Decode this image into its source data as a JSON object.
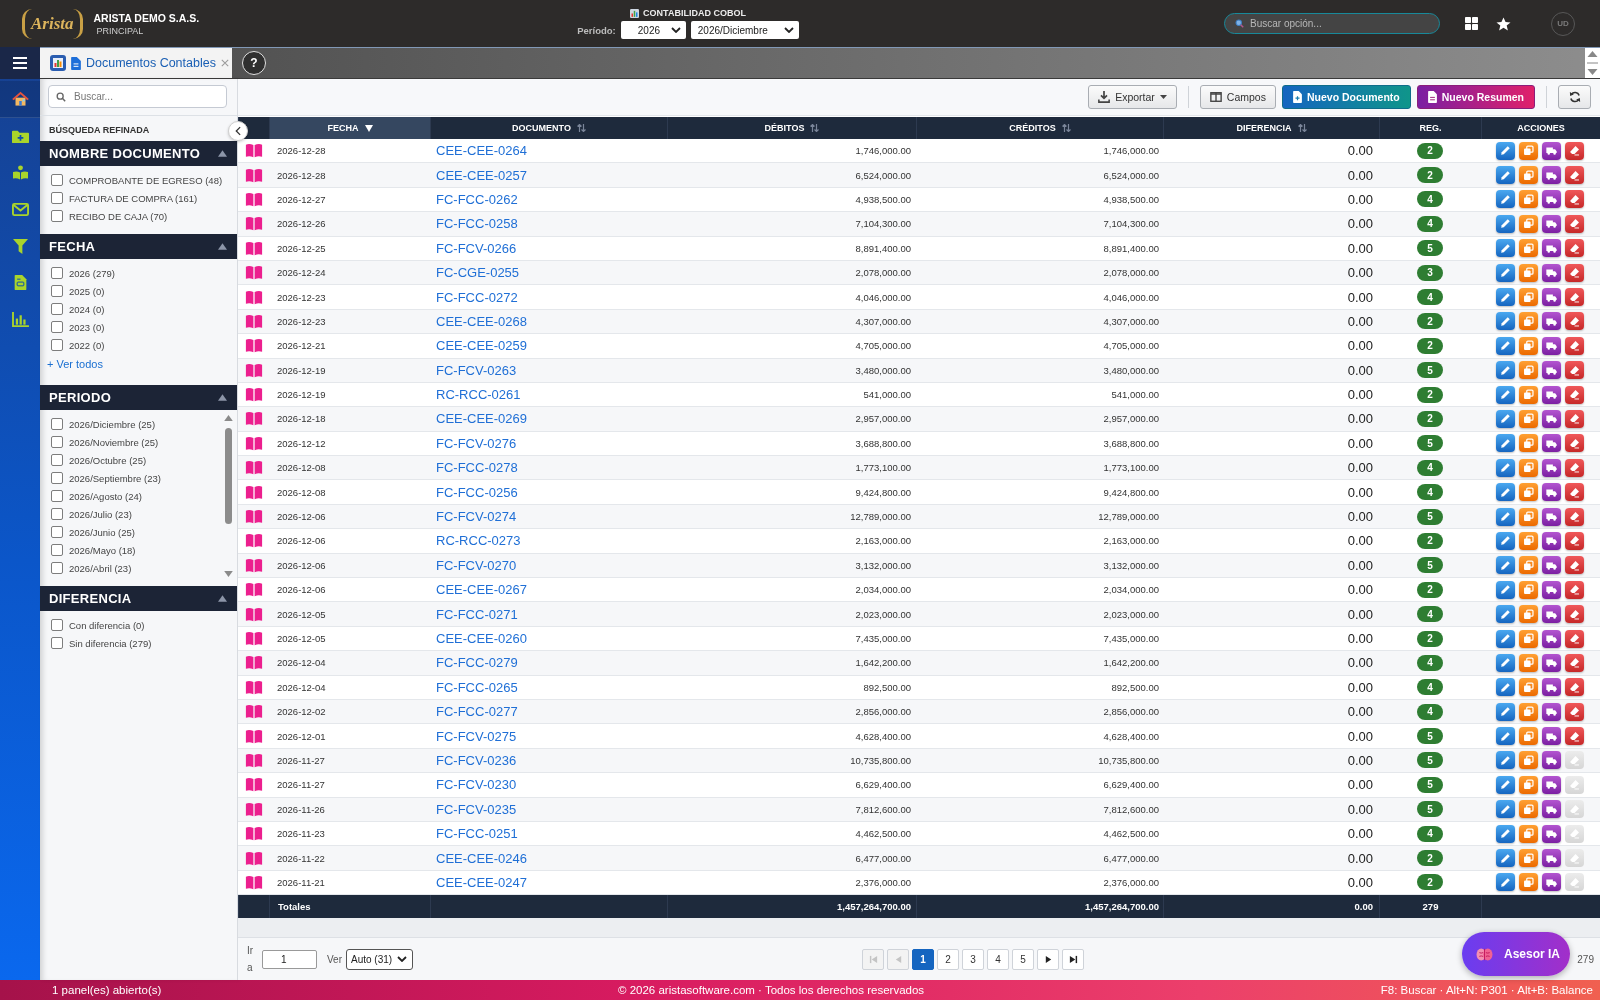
{
  "header": {
    "logo": "Arista",
    "company": "ARISTA DEMO S.A.S.",
    "branch": "PRINCIPAL",
    "module": "CONTABILIDAD COBOL",
    "period_label": "Período:",
    "year": "2026",
    "month": "2026/Diciembre",
    "search": {
      "placeholder": "Buscar opción..."
    },
    "avatar": "UD"
  },
  "nav_items": [
    {
      "kind": "home",
      "selected": true
    },
    {
      "kind": "folder-plus",
      "selected": false
    },
    {
      "kind": "reader",
      "selected": false
    },
    {
      "kind": "mail",
      "selected": false
    },
    {
      "kind": "filter",
      "selected": false
    },
    {
      "kind": "report",
      "selected": false
    },
    {
      "kind": "chart",
      "selected": false
    }
  ],
  "tabs": [
    {
      "label": "Documentos Contables",
      "selected": true
    }
  ],
  "help_button": "?",
  "filters": {
    "search": {
      "placeholder": "Buscar..."
    },
    "title": "BÚSQUEDA REFINADA",
    "sections": [
      {
        "title": "NOMBRE DOCUMENTO",
        "expanded": true,
        "kind": "list",
        "items": [
          {
            "label": "COMPROBANTE DE EGRESO (48)",
            "checked": false
          },
          {
            "label": "FACTURA DE COMPRA (161)",
            "checked": false
          },
          {
            "label": "RECIBO DE CAJA (70)",
            "checked": false
          }
        ]
      },
      {
        "title": "FECHA",
        "expanded": true,
        "kind": "list",
        "items": [
          {
            "label": "2026 (279)",
            "checked": false
          },
          {
            "label": "2025 (0)",
            "checked": false
          },
          {
            "label": "2024 (0)",
            "checked": false
          },
          {
            "label": "2023 (0)",
            "checked": false
          },
          {
            "label": "2022 (0)",
            "checked": false
          }
        ],
        "more_link": "+ Ver todos"
      },
      {
        "title": "PERIODO",
        "expanded": true,
        "kind": "scroll",
        "items": [
          {
            "label": "2026/Diciembre (25)",
            "checked": false
          },
          {
            "label": "2026/Noviembre (25)",
            "checked": false
          },
          {
            "label": "2026/Octubre (25)",
            "checked": false
          },
          {
            "label": "2026/Septiembre (23)",
            "checked": false
          },
          {
            "label": "2026/Agosto (24)",
            "checked": false
          },
          {
            "label": "2026/Julio (23)",
            "checked": false
          },
          {
            "label": "2026/Junio (25)",
            "checked": false
          },
          {
            "label": "2026/Mayo (18)",
            "checked": false
          },
          {
            "label": "2026/Abril (23)",
            "checked": false
          }
        ]
      },
      {
        "title": "DIFERENCIA",
        "expanded": true,
        "kind": "list",
        "items": [
          {
            "label": "Con diferencia (0)",
            "checked": false
          },
          {
            "label": "Sin diferencia (279)",
            "checked": false
          }
        ]
      }
    ]
  },
  "toolbar": {
    "buttons": [
      {
        "kind": "export",
        "label": "Exportar"
      },
      {
        "kind": "fields",
        "label": "Campos"
      },
      {
        "kind": "new-document",
        "label": "Nuevo Documento"
      },
      {
        "kind": "new-summary",
        "label": "Nuevo Resumen"
      },
      {
        "kind": "refresh"
      }
    ]
  },
  "table": {
    "columns": [
      {
        "label": "FECHA",
        "sortable": true,
        "sorted": true
      },
      {
        "label": "DOCUMENTO",
        "sortable": true,
        "sorted": false
      },
      {
        "label": "DÉBITOS",
        "sortable": true,
        "sorted": false
      },
      {
        "label": "CRÉDITOS",
        "sortable": true,
        "sorted": false
      },
      {
        "label": "DIFERENCIA",
        "sortable": true,
        "sorted": false
      },
      {
        "label": "REG.",
        "sortable": false,
        "sorted": false
      },
      {
        "label": "ACCIONES",
        "sortable": false,
        "sorted": false
      }
    ],
    "rows": [
      {
        "date": "2026-12-28",
        "document": "CEE-CEE-0264",
        "debit": "1,746,000.00",
        "credit": "1,746,000.00",
        "difference": "0.00",
        "entries": "2",
        "delete_disabled": false
      },
      {
        "date": "2026-12-28",
        "document": "CEE-CEE-0257",
        "debit": "6,524,000.00",
        "credit": "6,524,000.00",
        "difference": "0.00",
        "entries": "2",
        "delete_disabled": false
      },
      {
        "date": "2026-12-27",
        "document": "FC-FCC-0262",
        "debit": "4,938,500.00",
        "credit": "4,938,500.00",
        "difference": "0.00",
        "entries": "4",
        "delete_disabled": false
      },
      {
        "date": "2026-12-26",
        "document": "FC-FCC-0258",
        "debit": "7,104,300.00",
        "credit": "7,104,300.00",
        "difference": "0.00",
        "entries": "4",
        "delete_disabled": false
      },
      {
        "date": "2026-12-25",
        "document": "FC-FCV-0266",
        "debit": "8,891,400.00",
        "credit": "8,891,400.00",
        "difference": "0.00",
        "entries": "5",
        "delete_disabled": false
      },
      {
        "date": "2026-12-24",
        "document": "FC-CGE-0255",
        "debit": "2,078,000.00",
        "credit": "2,078,000.00",
        "difference": "0.00",
        "entries": "3",
        "delete_disabled": false
      },
      {
        "date": "2026-12-23",
        "document": "FC-FCC-0272",
        "debit": "4,046,000.00",
        "credit": "4,046,000.00",
        "difference": "0.00",
        "entries": "4",
        "delete_disabled": false
      },
      {
        "date": "2026-12-23",
        "document": "CEE-CEE-0268",
        "debit": "4,307,000.00",
        "credit": "4,307,000.00",
        "difference": "0.00",
        "entries": "2",
        "delete_disabled": false
      },
      {
        "date": "2026-12-21",
        "document": "CEE-CEE-0259",
        "debit": "4,705,000.00",
        "credit": "4,705,000.00",
        "difference": "0.00",
        "entries": "2",
        "delete_disabled": false
      },
      {
        "date": "2026-12-19",
        "document": "FC-FCV-0263",
        "debit": "3,480,000.00",
        "credit": "3,480,000.00",
        "difference": "0.00",
        "entries": "5",
        "delete_disabled": false
      },
      {
        "date": "2026-12-19",
        "document": "RC-RCC-0261",
        "debit": "541,000.00",
        "credit": "541,000.00",
        "difference": "0.00",
        "entries": "2",
        "delete_disabled": false
      },
      {
        "date": "2026-12-18",
        "document": "CEE-CEE-0269",
        "debit": "2,957,000.00",
        "credit": "2,957,000.00",
        "difference": "0.00",
        "entries": "2",
        "delete_disabled": false
      },
      {
        "date": "2026-12-12",
        "document": "FC-FCV-0276",
        "debit": "3,688,800.00",
        "credit": "3,688,800.00",
        "difference": "0.00",
        "entries": "5",
        "delete_disabled": false
      },
      {
        "date": "2026-12-08",
        "document": "FC-FCC-0278",
        "debit": "1,773,100.00",
        "credit": "1,773,100.00",
        "difference": "0.00",
        "entries": "4",
        "delete_disabled": false
      },
      {
        "date": "2026-12-08",
        "document": "FC-FCC-0256",
        "debit": "9,424,800.00",
        "credit": "9,424,800.00",
        "difference": "0.00",
        "entries": "4",
        "delete_disabled": false
      },
      {
        "date": "2026-12-06",
        "document": "FC-FCV-0274",
        "debit": "12,789,000.00",
        "credit": "12,789,000.00",
        "difference": "0.00",
        "entries": "5",
        "delete_disabled": false
      },
      {
        "date": "2026-12-06",
        "document": "RC-RCC-0273",
        "debit": "2,163,000.00",
        "credit": "2,163,000.00",
        "difference": "0.00",
        "entries": "2",
        "delete_disabled": false
      },
      {
        "date": "2026-12-06",
        "document": "FC-FCV-0270",
        "debit": "3,132,000.00",
        "credit": "3,132,000.00",
        "difference": "0.00",
        "entries": "5",
        "delete_disabled": false
      },
      {
        "date": "2026-12-06",
        "document": "CEE-CEE-0267",
        "debit": "2,034,000.00",
        "credit": "2,034,000.00",
        "difference": "0.00",
        "entries": "2",
        "delete_disabled": false
      },
      {
        "date": "2026-12-05",
        "document": "FC-FCC-0271",
        "debit": "2,023,000.00",
        "credit": "2,023,000.00",
        "difference": "0.00",
        "entries": "4",
        "delete_disabled": false
      },
      {
        "date": "2026-12-05",
        "document": "CEE-CEE-0260",
        "debit": "7,435,000.00",
        "credit": "7,435,000.00",
        "difference": "0.00",
        "entries": "2",
        "delete_disabled": false
      },
      {
        "date": "2026-12-04",
        "document": "FC-FCC-0279",
        "debit": "1,642,200.00",
        "credit": "1,642,200.00",
        "difference": "0.00",
        "entries": "4",
        "delete_disabled": false
      },
      {
        "date": "2026-12-04",
        "document": "FC-FCC-0265",
        "debit": "892,500.00",
        "credit": "892,500.00",
        "difference": "0.00",
        "entries": "4",
        "delete_disabled": false
      },
      {
        "date": "2026-12-02",
        "document": "FC-FCC-0277",
        "debit": "2,856,000.00",
        "credit": "2,856,000.00",
        "difference": "0.00",
        "entries": "4",
        "delete_disabled": false
      },
      {
        "date": "2026-12-01",
        "document": "FC-FCV-0275",
        "debit": "4,628,400.00",
        "credit": "4,628,400.00",
        "difference": "0.00",
        "entries": "5",
        "delete_disabled": false
      },
      {
        "date": "2026-11-27",
        "document": "FC-FCV-0236",
        "debit": "10,735,800.00",
        "credit": "10,735,800.00",
        "difference": "0.00",
        "entries": "5",
        "delete_disabled": true
      },
      {
        "date": "2026-11-27",
        "document": "FC-FCV-0230",
        "debit": "6,629,400.00",
        "credit": "6,629,400.00",
        "difference": "0.00",
        "entries": "5",
        "delete_disabled": true
      },
      {
        "date": "2026-11-26",
        "document": "FC-FCV-0235",
        "debit": "7,812,600.00",
        "credit": "7,812,600.00",
        "difference": "0.00",
        "entries": "5",
        "delete_disabled": true
      },
      {
        "date": "2026-11-23",
        "document": "FC-FCC-0251",
        "debit": "4,462,500.00",
        "credit": "4,462,500.00",
        "difference": "0.00",
        "entries": "4",
        "delete_disabled": true
      },
      {
        "date": "2026-11-22",
        "document": "CEE-CEE-0246",
        "debit": "6,477,000.00",
        "credit": "6,477,000.00",
        "difference": "0.00",
        "entries": "2",
        "delete_disabled": true
      },
      {
        "date": "2026-11-21",
        "document": "CEE-CEE-0247",
        "debit": "2,376,000.00",
        "credit": "2,376,000.00",
        "difference": "0.00",
        "entries": "2",
        "delete_disabled": true
      }
    ],
    "totals": {
      "label": "Totales",
      "debit": "1,457,264,700.00",
      "credit": "1,457,264,700.00",
      "difference": "0.00",
      "entries": "279"
    }
  },
  "pagination": {
    "goto_label": "Ir a",
    "goto_value": "1",
    "view_label": "Ver",
    "view_value": "Auto (31)",
    "nav_start": [
      {
        "kind": "first",
        "disabled": true
      },
      {
        "kind": "prev",
        "disabled": true
      }
    ],
    "pages": [
      {
        "label": "1",
        "selected": true
      },
      {
        "label": "2",
        "selected": false
      },
      {
        "label": "3",
        "selected": false
      },
      {
        "label": "4",
        "selected": false
      },
      {
        "label": "5",
        "selected": false
      }
    ],
    "nav_end": [
      {
        "kind": "next",
        "disabled": false
      },
      {
        "kind": "last",
        "disabled": false
      }
    ],
    "total": "279"
  },
  "assistant_button": {
    "label": "Asesor IA"
  },
  "status_bar": {
    "panels": "1 panel(es) abierto(s)",
    "copyright": "© 2026 aristasoftware.com · Todos los derechos reservados",
    "shortcuts": "F8: Buscar · Alt+N: P301 · Alt+B: Balance"
  }
}
